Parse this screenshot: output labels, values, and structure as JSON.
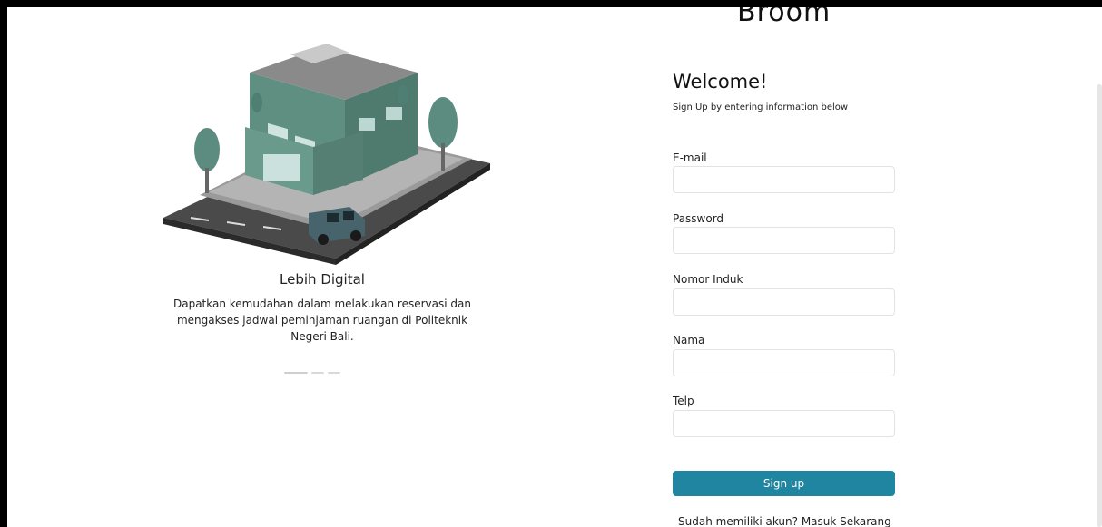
{
  "brand": {
    "name": "Broom"
  },
  "promo": {
    "title": "Lebih Digital",
    "description": "Dapatkan kemudahan dalam melakukan reservasi dan mengakses jadwal peminjaman ruangan di Politeknik Negeri Bali.",
    "illustration_icon": "building-illustration"
  },
  "form": {
    "welcome": "Welcome!",
    "subtitle": "Sign Up by entering information below",
    "fields": [
      {
        "label": "E-mail",
        "value": "",
        "placeholder": ""
      },
      {
        "label": "Password",
        "value": "",
        "placeholder": ""
      },
      {
        "label": "Nomor Induk",
        "value": "",
        "placeholder": ""
      },
      {
        "label": "Nama",
        "value": "",
        "placeholder": ""
      },
      {
        "label": "Telp",
        "value": "",
        "placeholder": ""
      }
    ],
    "submit_label": "Sign up",
    "login_prompt": "Sudah memiliki akun?",
    "login_link": "Masuk Sekarang"
  },
  "colors": {
    "primary_button": "#1f85a1",
    "building": "#5f8f80",
    "road": "#3a3a3a"
  }
}
